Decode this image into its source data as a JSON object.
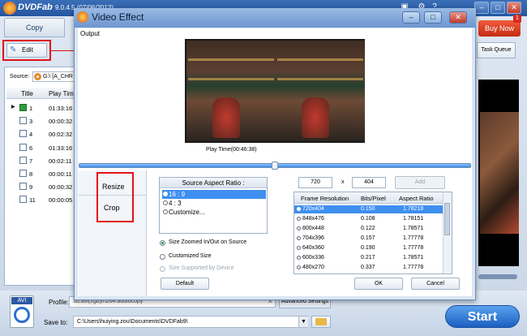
{
  "main_window": {
    "app_name": "DVDFab",
    "version": "9.0.4.5 (07/06/2012)",
    "tabs": {
      "copy": "Copy"
    },
    "buy_now": "Buy Now",
    "buy_badge": "1",
    "edit_button": "Edit",
    "task_queue": "Task Queue",
    "source_label": "Source:",
    "source_value": "G:\\ [A_CHR",
    "list_header": {
      "title": "Title",
      "play_time": "Play Tim"
    },
    "titles": [
      {
        "id": "1",
        "time": "01:33:16",
        "checked": true
      },
      {
        "id": "3",
        "time": "00:00:32",
        "checked": false
      },
      {
        "id": "4",
        "time": "00:02:32",
        "checked": false
      },
      {
        "id": "6",
        "time": "01:33:16",
        "checked": false
      },
      {
        "id": "7",
        "time": "00:02:11",
        "checked": false
      },
      {
        "id": "8",
        "time": "00:00:11",
        "checked": false
      },
      {
        "id": "9",
        "time": "00:00:32",
        "checked": false
      },
      {
        "id": "11",
        "time": "00:00:05",
        "checked": false
      }
    ],
    "profile_label": "Profile:",
    "profile_value": "3d.avi(2gb)/h264.audiocopy",
    "advanced_settings": "Advanced Settings",
    "save_to_label": "Save to:",
    "save_to_value": "C:\\Users\\huiying.zou\\Documents\\DVDFab9\\",
    "avi_label": "AVI",
    "start": "Start"
  },
  "dialog": {
    "title": "Video Effect",
    "output_label": "Output",
    "play_time": "Play Time(00:46:38)",
    "tabs": {
      "resize": "Resize",
      "crop": "Crop"
    },
    "aspect_header": "Source Aspect Ratio :",
    "aspect_options": [
      "16 : 9",
      "4 : 3",
      "Customize..."
    ],
    "size_options": [
      "Size Zoomed In/Out on Source",
      "Customized Size",
      "Size Supported by Device"
    ],
    "width": "720",
    "x_label": "x",
    "height": "404",
    "add": "Add",
    "table_headers": {
      "res": "Frame Resolution",
      "bits": "Bits/Pixel",
      "aspect": "Aspect Ratio"
    },
    "resolutions": [
      {
        "res": "720x404",
        "bits": "0.150",
        "aspect": "1.78218"
      },
      {
        "res": "848x476",
        "bits": "0.108",
        "aspect": "1.78151"
      },
      {
        "res": "800x448",
        "bits": "0.122",
        "aspect": "1.78571"
      },
      {
        "res": "704x396",
        "bits": "0.157",
        "aspect": "1.77778"
      },
      {
        "res": "640x360",
        "bits": "0.190",
        "aspect": "1.77778"
      },
      {
        "res": "600x336",
        "bits": "0.217",
        "aspect": "1.78571"
      },
      {
        "res": "480x270",
        "bits": "0.337",
        "aspect": "1.77778"
      }
    ],
    "default": "Default",
    "ok": "OK",
    "cancel": "Cancel"
  }
}
